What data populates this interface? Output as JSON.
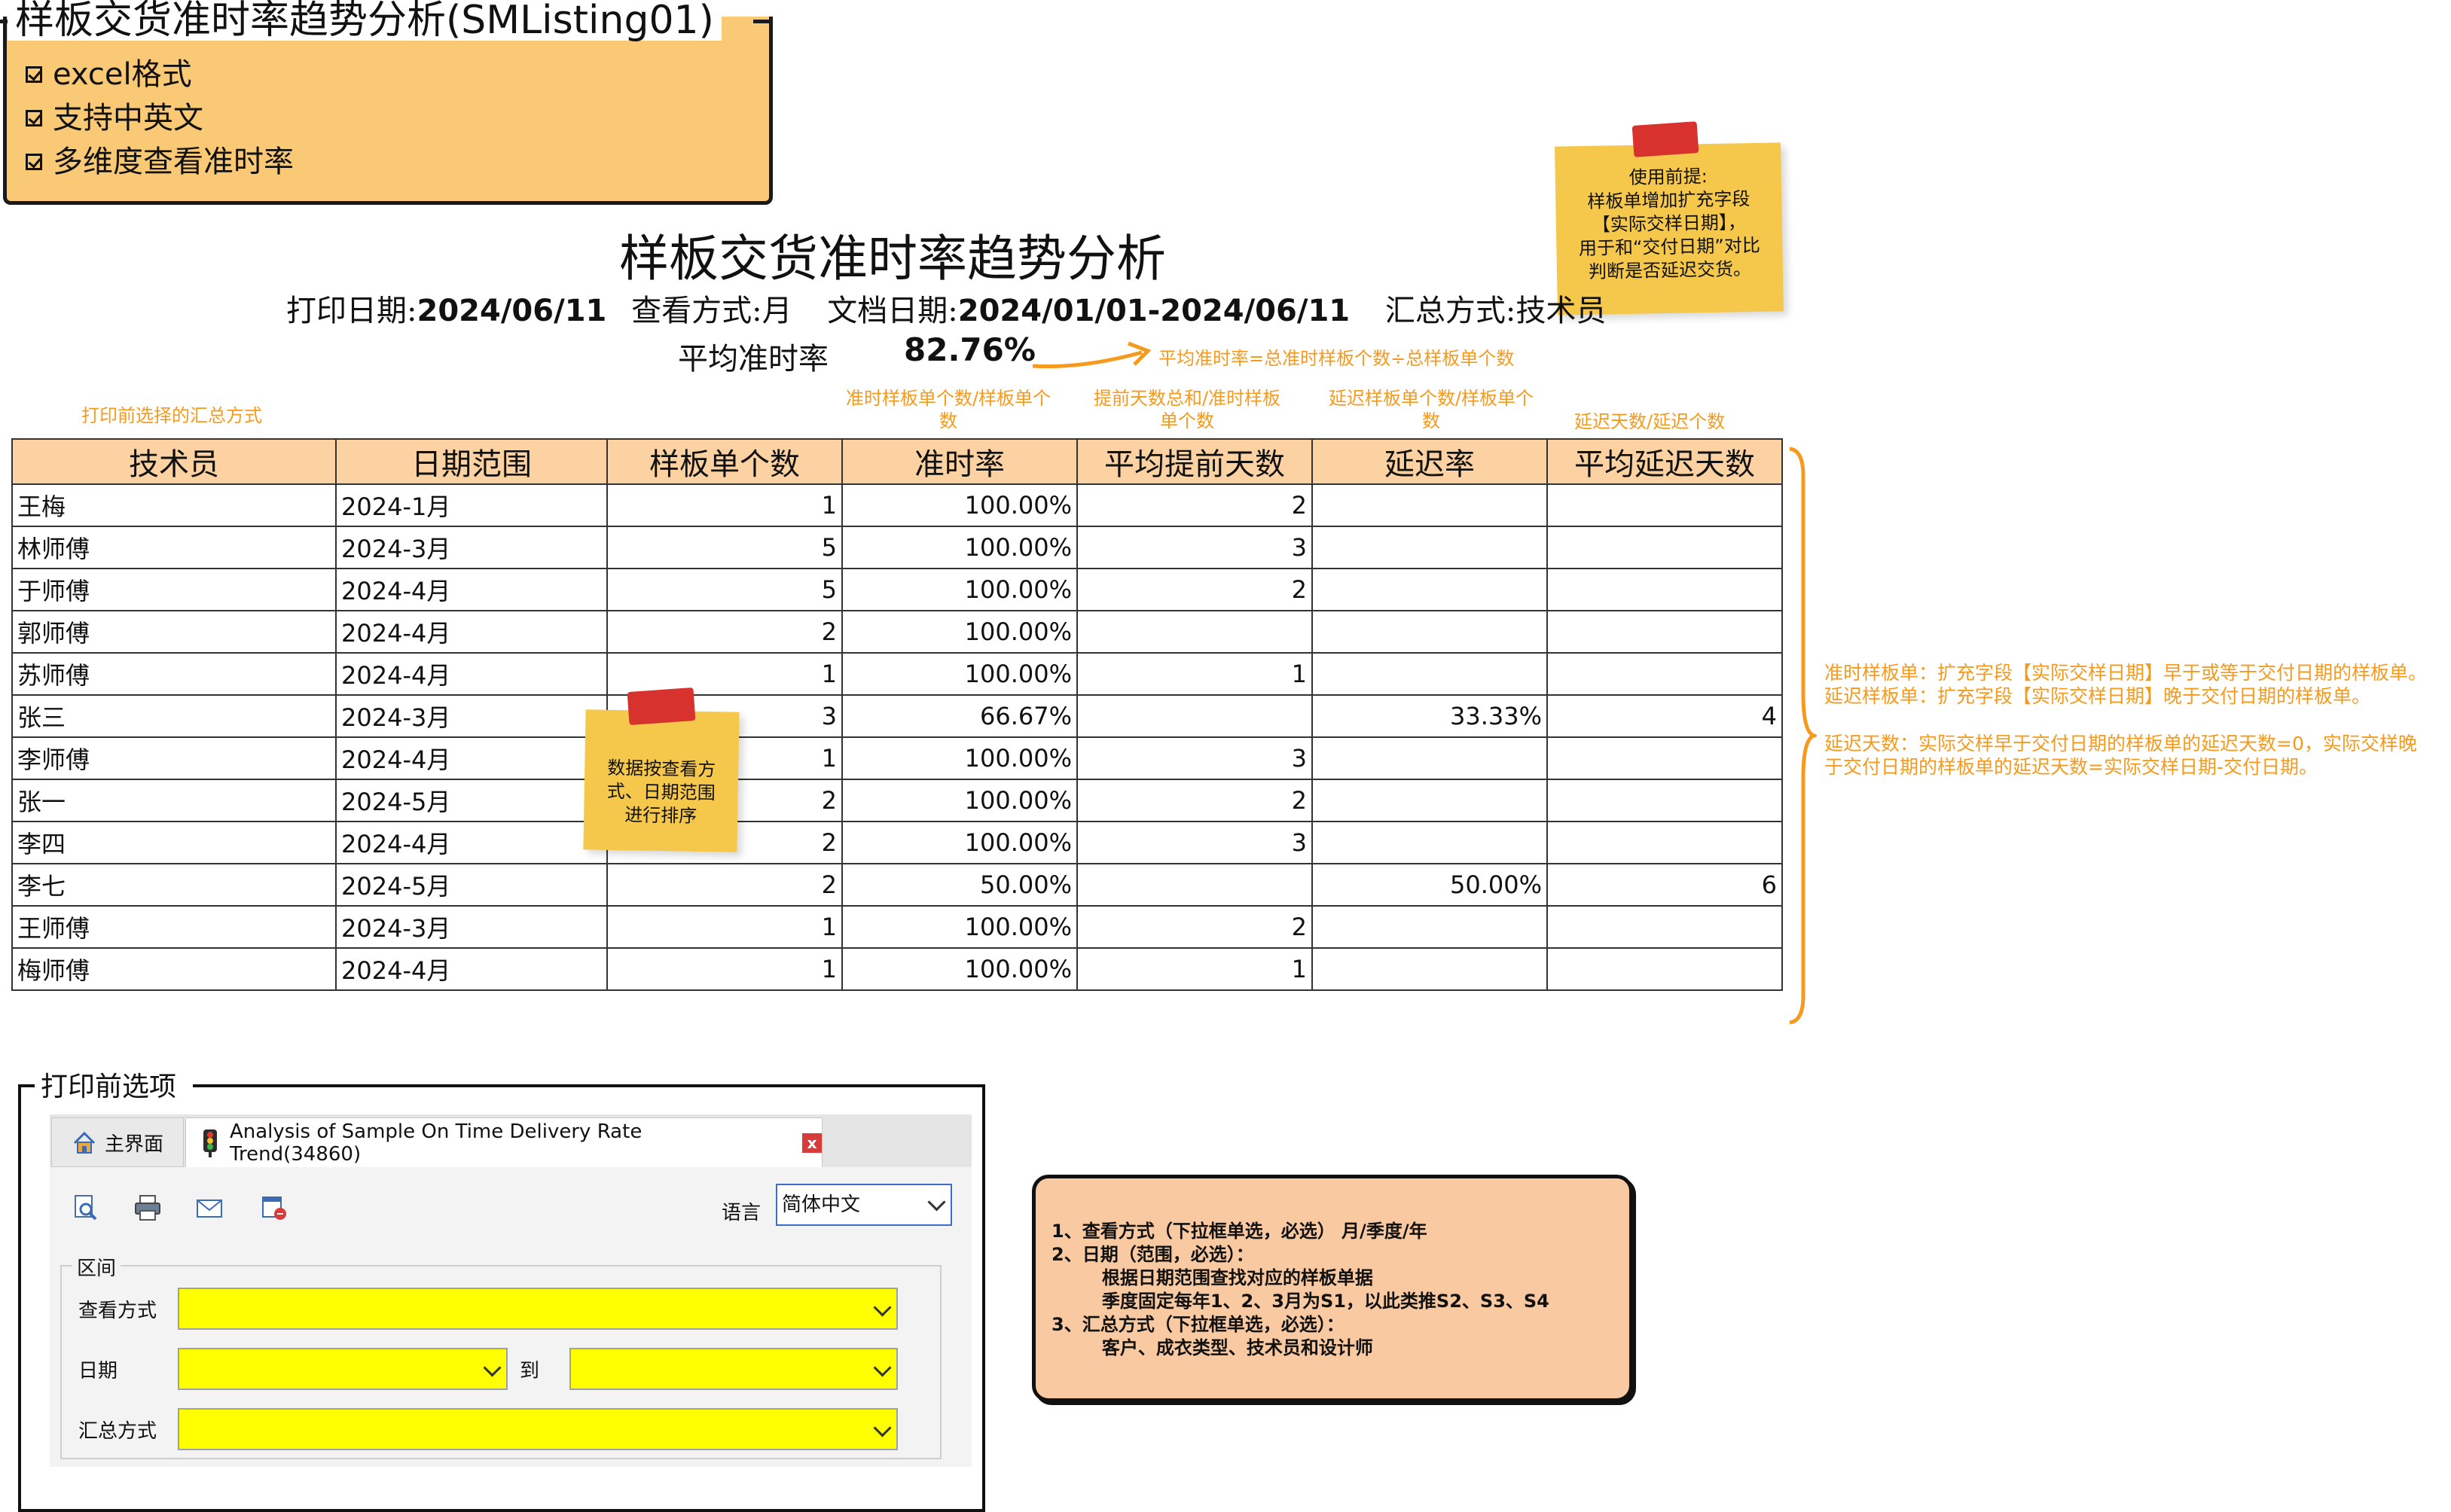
{
  "feature_card": {
    "title": "样板交货准时率趋势分析(SMListing01)",
    "items": [
      "excel格式",
      "支持中英文",
      "多维度查看准时率"
    ]
  },
  "sticky_top": {
    "lines": [
      "使用前提:",
      "样板单增加扩充字段",
      "【实际交样日期】，",
      "用于和“交付日期”对比",
      "判断是否延迟交货。"
    ]
  },
  "sticky_mid": {
    "lines": [
      "数据按查看方",
      "式、日期范围",
      "进行排序"
    ]
  },
  "report": {
    "title": "样板交货准时率趋势分析",
    "print_date_label": "打印日期:",
    "print_date": "2024/06/11",
    "view_mode_label": "查看方式:",
    "view_mode": "月",
    "doc_date_label": "文档日期:",
    "doc_date": "2024/01/01-2024/06/11",
    "summary_label": "汇总方式:",
    "summary": "技术员",
    "avg_label": "平均准时率",
    "avg_value": "82.76%"
  },
  "notes": {
    "avg_formula": "平均准时率=总准时样板个数÷总样板单个数",
    "summary_choice": "打印前选择的汇总方式",
    "ontime_rate": "准时样板单个数/样板单个数",
    "avg_early": "提前天数总和/准时样板单个数",
    "delay_rate": "延迟样板单个数/样板单个数",
    "avg_delay": "延迟天数/延迟个数"
  },
  "table": {
    "headers": [
      "技术员",
      "日期范围",
      "样板单个数",
      "准时率",
      "平均提前天数",
      "延迟率",
      "平均延迟天数"
    ],
    "rows": [
      [
        "王梅",
        "2024-1月",
        "1",
        "100.00%",
        "2",
        "",
        ""
      ],
      [
        "林师傅",
        "2024-3月",
        "5",
        "100.00%",
        "3",
        "",
        ""
      ],
      [
        "于师傅",
        "2024-4月",
        "5",
        "100.00%",
        "2",
        "",
        ""
      ],
      [
        "郭师傅",
        "2024-4月",
        "2",
        "100.00%",
        "",
        "",
        ""
      ],
      [
        "苏师傅",
        "2024-4月",
        "1",
        "100.00%",
        "1",
        "",
        ""
      ],
      [
        "张三",
        "2024-3月",
        "3",
        "66.67%",
        "",
        "33.33%",
        "4"
      ],
      [
        "李师傅",
        "2024-4月",
        "1",
        "100.00%",
        "3",
        "",
        ""
      ],
      [
        "张一",
        "2024-5月",
        "2",
        "100.00%",
        "2",
        "",
        ""
      ],
      [
        "李四",
        "2024-4月",
        "2",
        "100.00%",
        "3",
        "",
        ""
      ],
      [
        "李七",
        "2024-5月",
        "2",
        "50.00%",
        "",
        "50.00%",
        "6"
      ],
      [
        "王师傅",
        "2024-3月",
        "1",
        "100.00%",
        "2",
        "",
        ""
      ],
      [
        "梅师傅",
        "2024-4月",
        "1",
        "100.00%",
        "1",
        "",
        ""
      ]
    ]
  },
  "right_notes": {
    "line1": "准时样板单：扩充字段【实际交样日期】早于或等于交付日期的样板单。",
    "line2": "延迟样板单：扩充字段【实际交样日期】晚于交付日期的样板单。",
    "line3": "延迟天数：实际交样早于交付日期的样板单的延迟天数=0，实际交样晚",
    "line4": "于交付日期的样板单的延迟天数=实际交样日期-交付日期。"
  },
  "options_panel": {
    "frame_title": "打印前选项",
    "tab_main": "主界面",
    "tab_active": "Analysis of Sample On Time Delivery Rate Trend(34860)",
    "tab_close": "x",
    "lang_label": "语言",
    "lang_value": "简体中文",
    "group_title": "区间",
    "view_mode_label": "查看方式",
    "date_label": "日期",
    "to_label": "到",
    "summary_label": "汇总方式",
    "icons": [
      "preview-icon",
      "print-icon",
      "email-icon",
      "export-icon"
    ]
  },
  "info_card": {
    "text": "1、查看方式（下拉框单选，必选） 月/季度/年\n2、日期（范围，必选）：\n        根据日期范围查找对应的样板单据\n        季度固定每年1、2、3月为S1，以此类推S2、S3、S4\n3、汇总方式（下拉框单选，必选）：\n        客户、成衣类型、技术员和设计师"
  },
  "colors": {
    "feature_card_bg": "#f9c975",
    "table_header_bg": "#fcd2a3",
    "note_orange": "#f59a1d",
    "sticky_yellow": "#f5c84c",
    "field_yellow": "#ffff00",
    "info_card_bg": "#f9c9a2"
  }
}
